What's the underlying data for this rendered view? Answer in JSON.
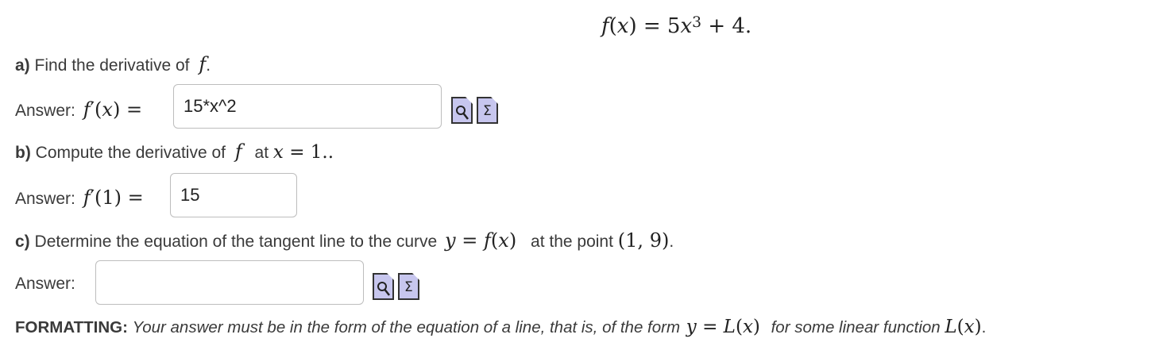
{
  "display": {
    "f": "f",
    "x": "x",
    "eq": "= 5",
    "x2": "x",
    "exp": "3",
    "tail": "+ 4."
  },
  "part_a": {
    "label": "a)",
    "text": "Find the derivative of",
    "f": "f",
    "period": ".",
    "answer_label": "Answer:",
    "answer_value": "15*x^2"
  },
  "part_b": {
    "label": "b)",
    "text": "Compute the derivative of",
    "f": "f",
    "at": "at",
    "x": "x",
    "eq": "= 1..",
    "answer_label": "Answer:",
    "answer_value": "15"
  },
  "part_c": {
    "label": "c)",
    "text": "Determine the equation of the tangent line to the curve",
    "y": "y",
    "eq": "=",
    "f": "f",
    "x": "x",
    "at_point": "at the point",
    "point": "(1, 9)",
    "period": ".",
    "answer_label": "Answer:",
    "answer_value": ""
  },
  "formatting": {
    "label": "FORMATTING:",
    "text1": "Your answer must be in the form of the equation of a line, that is, of the form",
    "y": "y",
    "eq": "=",
    "L": "L",
    "x": "x",
    "text2": "for some linear function",
    "L2": "L",
    "x2": "x",
    "period": "."
  },
  "icons": [
    "preview-icon",
    "equation-editor-icon"
  ],
  "colors": {
    "icon_fill": "#c7c6ee",
    "input_border": "#bdbdbd",
    "text": "#3a3a3a"
  }
}
